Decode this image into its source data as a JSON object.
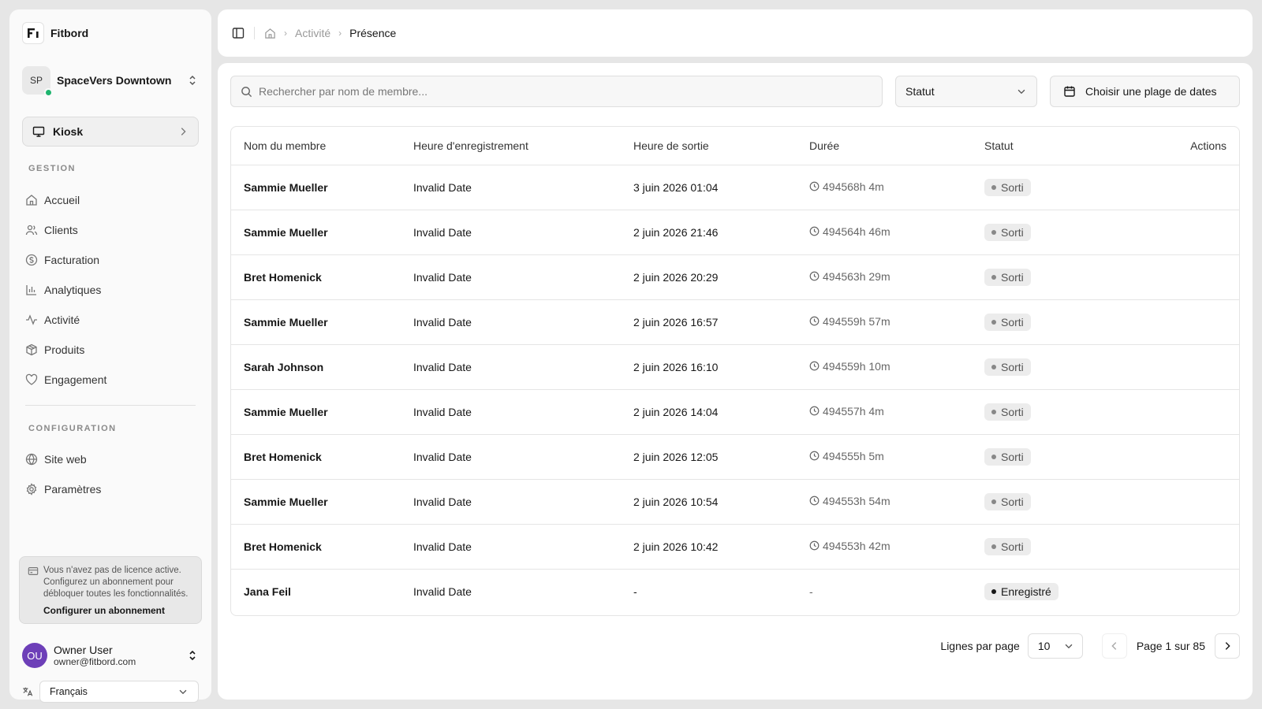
{
  "brand": {
    "name": "Fitbord"
  },
  "org": {
    "initials": "SP",
    "name": "SpaceVers Downtown"
  },
  "kiosk": {
    "label": "Kiosk"
  },
  "sidebar": {
    "gestion_title": "GESTION",
    "gestion_items": [
      {
        "label": "Accueil",
        "icon": "home-icon"
      },
      {
        "label": "Clients",
        "icon": "users-icon"
      },
      {
        "label": "Facturation",
        "icon": "dollar-icon"
      },
      {
        "label": "Analytiques",
        "icon": "bar-chart-icon"
      },
      {
        "label": "Activité",
        "icon": "activity-icon"
      },
      {
        "label": "Produits",
        "icon": "package-icon"
      },
      {
        "label": "Engagement",
        "icon": "heart-icon"
      }
    ],
    "config_title": "CONFIGURATION",
    "config_items": [
      {
        "label": "Site web",
        "icon": "globe-icon"
      },
      {
        "label": "Paramètres",
        "icon": "gear-icon"
      }
    ]
  },
  "license": {
    "text": "Vous n'avez pas de licence active. Configurez un abonnement pour débloquer toutes les fonctionnalités.",
    "link": "Configurer un abonnement"
  },
  "user": {
    "initials": "OU",
    "name": "Owner User",
    "email": "owner@fitbord.com"
  },
  "language": {
    "selected": "Français"
  },
  "breadcrumb": {
    "parent": "Activité",
    "current": "Présence"
  },
  "search": {
    "placeholder": "Rechercher par nom de membre..."
  },
  "filters": {
    "status_label": "Statut",
    "date_label": "Choisir une plage de dates"
  },
  "table": {
    "headers": {
      "name": "Nom du membre",
      "checkin": "Heure d'enregistrement",
      "checkout": "Heure de sortie",
      "duration": "Durée",
      "status": "Statut",
      "actions": "Actions"
    },
    "rows": [
      {
        "name": "Sammie Mueller",
        "checkin": "Invalid Date",
        "checkout": "3 juin 2026 01:04",
        "duration": "494568h 4m",
        "status": "Sorti"
      },
      {
        "name": "Sammie Mueller",
        "checkin": "Invalid Date",
        "checkout": "2 juin 2026 21:46",
        "duration": "494564h 46m",
        "status": "Sorti"
      },
      {
        "name": "Bret Homenick",
        "checkin": "Invalid Date",
        "checkout": "2 juin 2026 20:29",
        "duration": "494563h 29m",
        "status": "Sorti"
      },
      {
        "name": "Sammie Mueller",
        "checkin": "Invalid Date",
        "checkout": "2 juin 2026 16:57",
        "duration": "494559h 57m",
        "status": "Sorti"
      },
      {
        "name": "Sarah Johnson",
        "checkin": "Invalid Date",
        "checkout": "2 juin 2026 16:10",
        "duration": "494559h 10m",
        "status": "Sorti"
      },
      {
        "name": "Sammie Mueller",
        "checkin": "Invalid Date",
        "checkout": "2 juin 2026 14:04",
        "duration": "494557h 4m",
        "status": "Sorti"
      },
      {
        "name": "Bret Homenick",
        "checkin": "Invalid Date",
        "checkout": "2 juin 2026 12:05",
        "duration": "494555h 5m",
        "status": "Sorti"
      },
      {
        "name": "Sammie Mueller",
        "checkin": "Invalid Date",
        "checkout": "2 juin 2026 10:54",
        "duration": "494553h 54m",
        "status": "Sorti"
      },
      {
        "name": "Bret Homenick",
        "checkin": "Invalid Date",
        "checkout": "2 juin 2026 10:42",
        "duration": "494553h 42m",
        "status": "Sorti"
      },
      {
        "name": "Jana Feil",
        "checkin": "Invalid Date",
        "checkout": "-",
        "duration": "-",
        "status": "Enregistré"
      }
    ]
  },
  "pagination": {
    "rows_label": "Lignes par page",
    "rows_value": "10",
    "page_text": "Page 1 sur 85"
  },
  "colors": {
    "online": "#1fb46e",
    "user_avatar": "#6d3fb8"
  }
}
